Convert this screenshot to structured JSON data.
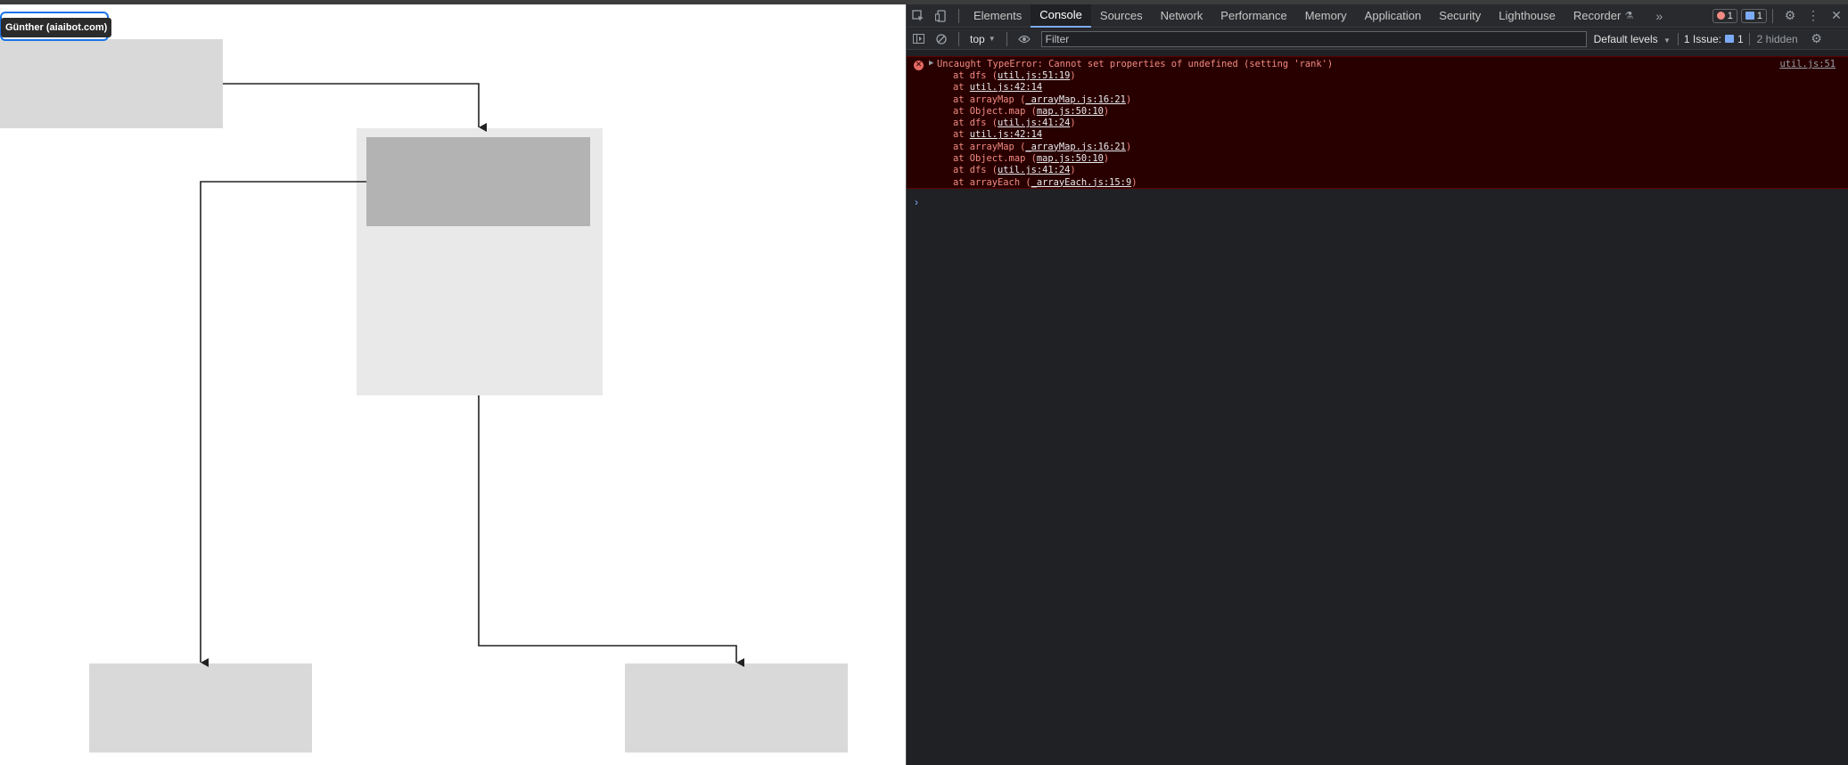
{
  "page": {
    "tooltip": "Günther (aiaibot.com)"
  },
  "devtools": {
    "tabs": [
      "Elements",
      "Console",
      "Sources",
      "Network",
      "Performance",
      "Memory",
      "Application",
      "Security",
      "Lighthouse",
      "Recorder"
    ],
    "active_tab": "Console",
    "more_tabs_icon": "chevron-double-right-icon",
    "error_badge_count": "1",
    "message_badge_count": "1",
    "toolbar": {
      "context": "top",
      "filter_placeholder": "Filter",
      "levels": "Default levels",
      "issues_label": "1 Issue:",
      "issues_count": "1",
      "hidden": "2 hidden"
    },
    "error": {
      "message": "Uncaught TypeError: Cannot set properties of undefined (setting 'rank')",
      "source": "util.js:51",
      "stack": [
        {
          "prefix": "at dfs (",
          "loc": "util.js:51:19",
          "suffix": ")"
        },
        {
          "prefix": "at ",
          "loc": "util.js:42:14",
          "suffix": ""
        },
        {
          "prefix": "at arrayMap (",
          "loc": "_arrayMap.js:16:21",
          "suffix": ")"
        },
        {
          "prefix": "at Object.map (",
          "loc": "map.js:50:10",
          "suffix": ")"
        },
        {
          "prefix": "at dfs (",
          "loc": "util.js:41:24",
          "suffix": ")"
        },
        {
          "prefix": "at ",
          "loc": "util.js:42:14",
          "suffix": ""
        },
        {
          "prefix": "at arrayMap (",
          "loc": "_arrayMap.js:16:21",
          "suffix": ")"
        },
        {
          "prefix": "at Object.map (",
          "loc": "map.js:50:10",
          "suffix": ")"
        },
        {
          "prefix": "at dfs (",
          "loc": "util.js:41:24",
          "suffix": ")"
        },
        {
          "prefix": "at arrayEach (",
          "loc": "_arrayEach.js:15:9",
          "suffix": ")"
        }
      ]
    },
    "prompt_symbol": "›"
  },
  "colors": {
    "node_fill": "#d9d9d9",
    "group_fill": "#e9e9e9",
    "inner_node_fill": "#b3b3b3",
    "edge_stroke": "#222222",
    "error_bg": "#290000",
    "error_text": "#f28b82"
  }
}
